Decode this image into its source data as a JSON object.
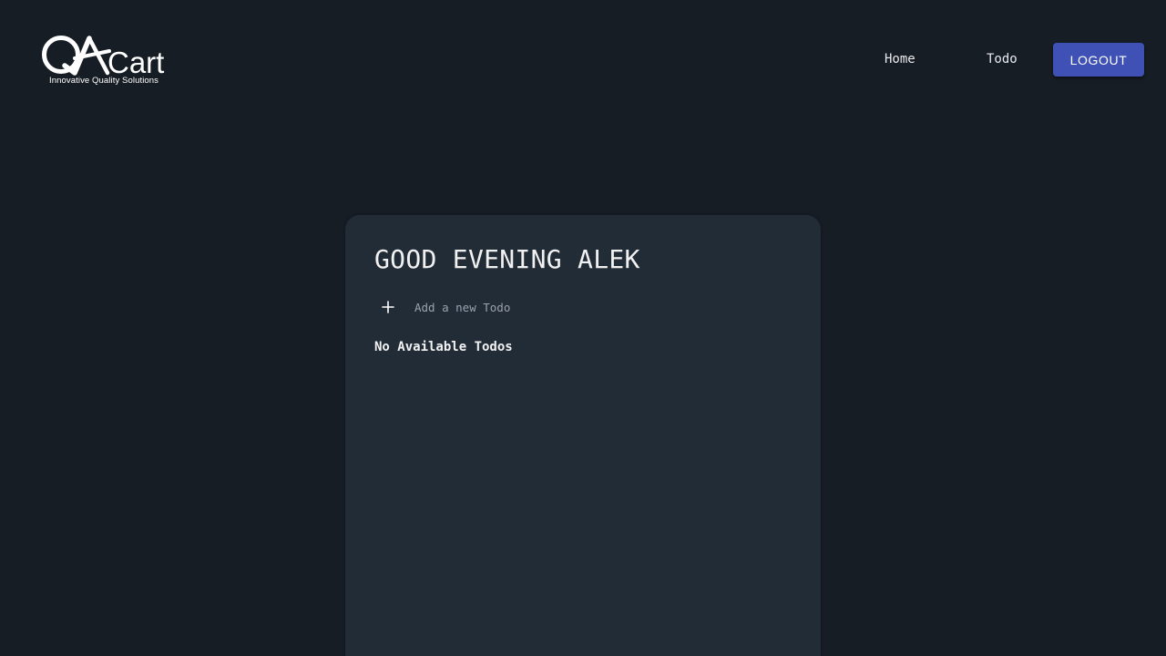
{
  "header": {
    "logo": {
      "brand_prefix": "QA",
      "brand_name": "Cart",
      "tagline": "Innovative Quality Solutions"
    },
    "nav": {
      "home_label": "Home",
      "todo_label": "Todo",
      "logout_label": "LOGOUT"
    }
  },
  "main": {
    "greeting": "GOOD EVENING ALEK",
    "add_todo_placeholder": "Add a new Todo",
    "empty_message": "No Available Todos"
  },
  "colors": {
    "background": "#171d25",
    "card": "#222c37",
    "accent": "#3f51b5",
    "text": "#f1f1f1",
    "muted_text": "#9aa2ad"
  },
  "icons": {
    "add": "plus-icon"
  }
}
